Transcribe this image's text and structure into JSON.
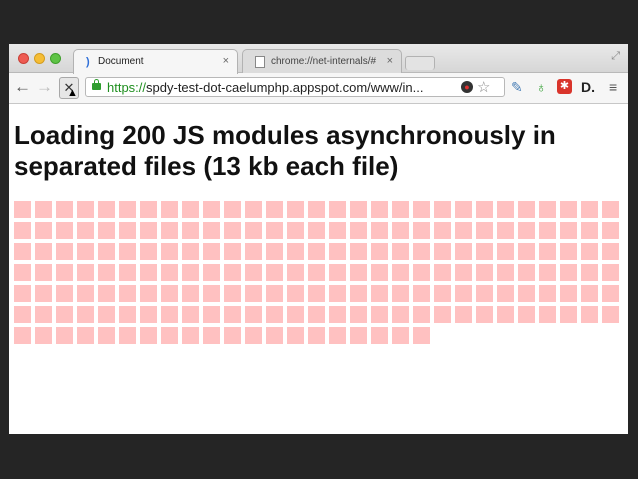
{
  "browser": {
    "tabs": [
      {
        "title": "Document",
        "active": true
      },
      {
        "title": "chrome://net-internals/#",
        "active": false
      }
    ],
    "address_bar": {
      "scheme": "https://",
      "url_rest": "spdy-test-dot-caelumphp.appspot.com/www/in..."
    },
    "icons": {
      "tab_close": "×",
      "back": "←",
      "forward": "→",
      "stop": "✕",
      "star": "☆",
      "menu": "≡",
      "fullscreen": "⤢",
      "eyedropper": "✎",
      "green_ext": "♁",
      "red_ext": "✱",
      "d_ext": "D."
    }
  },
  "page": {
    "heading": "Loading 200 JS modules asynchronously in separated files (13 kb each file)",
    "module_count": 200,
    "loaded_modules": 194,
    "module_color": "#ffc1c1"
  }
}
